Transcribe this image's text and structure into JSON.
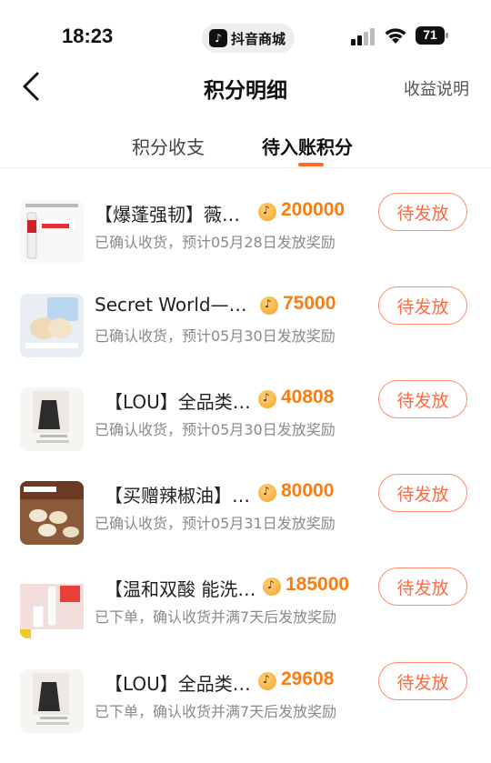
{
  "status_bar": {
    "time": "18:23",
    "app_pill": "抖音商城",
    "battery": "71"
  },
  "header": {
    "title": "积分明细",
    "explain_link": "收益说明"
  },
  "tabs": [
    {
      "label": "积分收支",
      "active": false
    },
    {
      "label": "待入账积分",
      "active": true
    }
  ],
  "accent": "#fe6a2b",
  "items": [
    {
      "name": "【爆蓬强韧】薇…",
      "points": "200000",
      "status": "已确认收货，预计05月28日发放奖励",
      "button": "待发放"
    },
    {
      "name": "Secret World—…",
      "points": "75000",
      "status": "已确认收货，预计05月30日发放奖励",
      "button": "待发放"
    },
    {
      "name": "【LOU】全品类…",
      "points": "40808",
      "status": "已确认收货，预计05月30日发放奖励",
      "button": "待发放"
    },
    {
      "name": "【买赠辣椒油】…",
      "points": "80000",
      "status": "已确认收货，预计05月31日发放奖励",
      "button": "待发放"
    },
    {
      "name": "【温和双酸 能洗…",
      "points": "185000",
      "status": "已下单，确认收货并满7天后发放奖励",
      "button": "待发放"
    },
    {
      "name": "【LOU】全品类…",
      "points": "29608",
      "status": "已下单，确认收货并满7天后发放奖励",
      "button": "待发放"
    }
  ]
}
